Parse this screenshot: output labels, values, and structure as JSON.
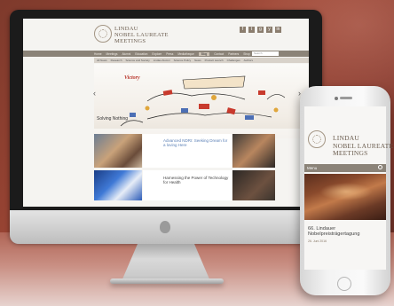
{
  "brand": {
    "name_lines": [
      "LINDAU",
      "NOBEL LAUREATE",
      "MEETINGS"
    ]
  },
  "desktop": {
    "social_icons": [
      "f",
      "t",
      "g",
      "y",
      "in"
    ],
    "main_nav": [
      "Home",
      "Meetings",
      "Alumni",
      "Education",
      "Explore",
      "Press",
      "Mediatheque",
      "Blog",
      "Contact",
      "Partners",
      "Shop"
    ],
    "active_nav": "Blog",
    "search_placeholder": "Search",
    "sub_nav": [
      "All News",
      "Research",
      "Science and Society",
      "Lindau Alumni",
      "Science Policy",
      "News",
      "Product Launch",
      "Challenges",
      "Authors"
    ],
    "hero": {
      "banner_text": "Victory",
      "title": "Solving Nothing"
    },
    "cards": [
      {
        "meta": "",
        "title": "Advanced NDRI: Seeking Dream for a loving Here"
      },
      {
        "meta": "",
        "title": "Harnessing the Power of Technology for Health"
      }
    ]
  },
  "mobile": {
    "menu_label": "Menu",
    "article": {
      "title": "66. Lindauer Nobelpreisträgertagung",
      "date": "26. Juni 2016"
    }
  },
  "colors": {
    "background": "#8a3c30",
    "nav": "#8b8378",
    "brand_text": "#6b5d4f"
  }
}
